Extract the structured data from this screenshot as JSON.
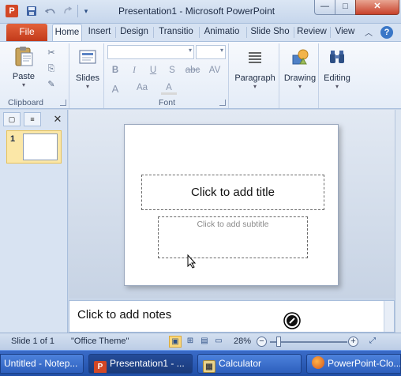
{
  "window": {
    "title": "Presentation1  -  Microsoft PowerPoint",
    "app_icon": "P",
    "controls": {
      "minimize": "—",
      "maximize": "□",
      "close": "✕"
    }
  },
  "quick_access": {
    "save_icon": "save-icon",
    "undo_icon": "undo-icon",
    "redo_icon": "redo-icon",
    "customize_icon": "customize-qat-icon"
  },
  "tabs": {
    "file": "File",
    "items": [
      "Home",
      "Insert",
      "Design",
      "Transitio",
      "Animatio",
      "Slide Sho",
      "Review",
      "View"
    ],
    "active": "Home"
  },
  "ribbon": {
    "clipboard": {
      "label": "Clipboard",
      "paste": "Paste"
    },
    "slides": {
      "label": "Slides"
    },
    "font": {
      "label": "Font",
      "bold": "B",
      "italic": "I",
      "underline": "U",
      "shadow": "S",
      "strike": "abc",
      "spacing": "AV",
      "grow": "A",
      "case": "Aa",
      "color": "A"
    },
    "paragraph": {
      "label": "Paragraph"
    },
    "drawing": {
      "label": "Drawing"
    },
    "editing": {
      "label": "Editing"
    }
  },
  "left_pane": {
    "slide_number": "1",
    "close": "✕"
  },
  "slide": {
    "title_placeholder": "Click to add title",
    "subtitle_placeholder": "Click to add subtitle"
  },
  "notes": {
    "placeholder": "Click to add notes"
  },
  "status": {
    "slide_info": "Slide 1 of 1",
    "theme": "\"Office Theme\"",
    "zoom": "28%",
    "zoom_out": "−",
    "zoom_in": "+",
    "zoom_level_fraction": 0.1
  },
  "taskbar": {
    "items": [
      {
        "label": "Untitled - Notep..."
      },
      {
        "label": "Presentation1 - ..."
      },
      {
        "label": "Calculator"
      },
      {
        "label": "PowerPoint-Clo..."
      }
    ]
  },
  "colors": {
    "file_tab": "#d24726",
    "ribbon_bg": "#e4ecf7",
    "accent_blue": "#2d5fbd"
  }
}
